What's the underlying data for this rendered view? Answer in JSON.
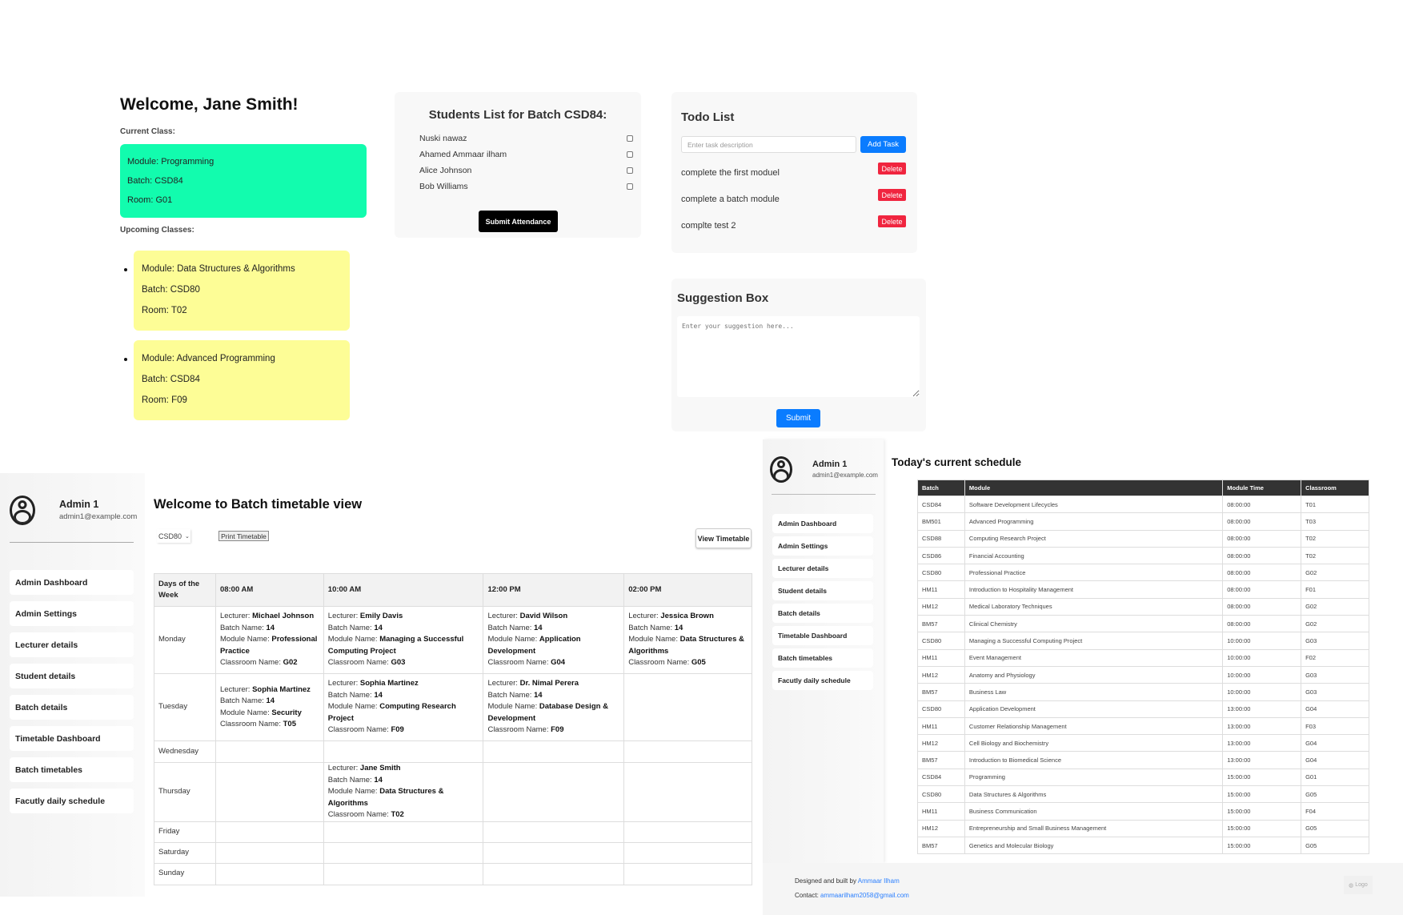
{
  "welcome": {
    "title": "Welcome, Jane Smith!",
    "current_label": "Current Class:",
    "current": {
      "module": "Module: Programming",
      "batch": "Batch: CSD84",
      "room": "Room: G01"
    },
    "upcoming_label": "Upcoming Classes:",
    "upcoming": [
      {
        "module": "Module: Data Structures & Algorithms",
        "batch": "Batch: CSD80",
        "room": "Room: T02"
      },
      {
        "module": "Module: Advanced Programming",
        "batch": "Batch: CSD84",
        "room": "Room: F09"
      }
    ]
  },
  "students": {
    "title": "Students List for Batch CSD84:",
    "list": [
      "Nuski nawaz",
      "Ahamed Ammaar ilham",
      "Alice Johnson",
      "Bob Williams"
    ],
    "submit": "Submit Attendance"
  },
  "todo": {
    "title": "Todo List",
    "placeholder": "Enter task description",
    "add": "Add Task",
    "tasks": [
      "complete the first moduel",
      "complete a batch module",
      "complte test 2"
    ],
    "delete": "Delete"
  },
  "suggestion": {
    "title": "Suggestion Box",
    "placeholder": "Enter your suggestion here...",
    "submit": "Submit"
  },
  "admin": {
    "name": "Admin 1",
    "email": "admin1@example.com",
    "nav": [
      "Admin Dashboard",
      "Admin Settings",
      "Lecturer details",
      "Student details",
      "Batch details",
      "Timetable Dashboard",
      "Batch timetables",
      "Facutly daily schedule"
    ]
  },
  "timetable": {
    "title": "Welcome to Batch timetable view",
    "batch_select": "CSD80",
    "print": "Print Timetable",
    "view": "View Timetable",
    "headers": [
      "Days of the Week",
      "08:00 AM",
      "10:00 AM",
      "12:00 PM",
      "02:00 PM"
    ],
    "labels": {
      "lecturer": "Lecturer: ",
      "batch": "Batch Name: ",
      "module": "Module Name: ",
      "room": "Classroom Name: "
    },
    "rows": [
      {
        "day": "Monday",
        "cells": [
          {
            "lecturer": "Michael Johnson",
            "batch": "14",
            "module": "Professional Practice",
            "room": "G02"
          },
          {
            "lecturer": "Emily Davis",
            "batch": "14",
            "module": "Managing a Successful Computing Project",
            "room": "G03"
          },
          {
            "lecturer": "David Wilson",
            "batch": "14",
            "module": "Application Development",
            "room": "G04"
          },
          {
            "lecturer": "Jessica Brown",
            "batch": "14",
            "module": "Data Structures & Algorithms",
            "room": "G05"
          }
        ]
      },
      {
        "day": "Tuesday",
        "cells": [
          {
            "lecturer": "Sophia Martinez",
            "batch": "14",
            "module": "Security",
            "room": "T05"
          },
          {
            "lecturer": "Sophia Martinez",
            "batch": "14",
            "module": "Computing Research Project",
            "room": "F09"
          },
          {
            "lecturer": "Dr. Nimal Perera",
            "batch": "14",
            "module": "Database Design & Development",
            "room": "F09"
          },
          null
        ]
      },
      {
        "day": "Wednesday",
        "cells": [
          null,
          null,
          null,
          null
        ]
      },
      {
        "day": "Thursday",
        "cells": [
          null,
          {
            "lecturer": "Jane Smith",
            "batch": "14",
            "module": "Data Structures & Algorithms",
            "room": "T02"
          },
          null,
          null
        ]
      },
      {
        "day": "Friday",
        "cells": [
          null,
          null,
          null,
          null
        ]
      },
      {
        "day": "Saturday",
        "cells": [
          null,
          null,
          null,
          null
        ]
      },
      {
        "day": "Sunday",
        "cells": [
          null,
          null,
          null,
          null
        ]
      }
    ]
  },
  "schedule": {
    "title": "Today's current schedule",
    "headers": [
      "Batch",
      "Module",
      "Module Time",
      "Classroom"
    ],
    "rows": [
      [
        "CSD84",
        "Software Development Lifecycles",
        "08:00:00",
        "T01"
      ],
      [
        "BM501",
        "Advanced Programming",
        "08:00:00",
        "T03"
      ],
      [
        "CSD88",
        "Computing Research Project",
        "08:00:00",
        "T02"
      ],
      [
        "CSD86",
        "Financial Accounting",
        "08:00:00",
        "T02"
      ],
      [
        "CSD80",
        "Professional Practice",
        "08:00:00",
        "G02"
      ],
      [
        "HM11",
        "Introduction to Hospitality Management",
        "08:00:00",
        "F01"
      ],
      [
        "HM12",
        "Medical Laboratory Techniques",
        "08:00:00",
        "G02"
      ],
      [
        "BM57",
        "Clinical Chemistry",
        "08:00:00",
        "G02"
      ],
      [
        "CSD80",
        "Managing a Successful Computing Project",
        "10:00:00",
        "G03"
      ],
      [
        "HM11",
        "Event Management",
        "10:00:00",
        "F02"
      ],
      [
        "HM12",
        "Anatomy and Physiology",
        "10:00:00",
        "G03"
      ],
      [
        "BM57",
        "Business Law",
        "10:00:00",
        "G03"
      ],
      [
        "CSD80",
        "Application Development",
        "13:00:00",
        "G04"
      ],
      [
        "HM11",
        "Customer Relationship Management",
        "13:00:00",
        "F03"
      ],
      [
        "HM12",
        "Cell Biology and Biochemistry",
        "13:00:00",
        "G04"
      ],
      [
        "BM57",
        "Introduction to Biomedical Science",
        "13:00:00",
        "G04"
      ],
      [
        "CSD84",
        "Programming",
        "15:00:00",
        "G01"
      ],
      [
        "CSD80",
        "Data Structures & Algorithms",
        "15:00:00",
        "G05"
      ],
      [
        "HM11",
        "Business Communication",
        "15:00:00",
        "F04"
      ],
      [
        "HM12",
        "Entrepreneurship and Small Business Management",
        "15:00:00",
        "G05"
      ],
      [
        "BM57",
        "Genetics and Molecular Biology",
        "15:00:00",
        "G05"
      ]
    ]
  },
  "footer": {
    "designed": "Designed and built by ",
    "author": "Ammaar Ilham",
    "contact": "Contact: ",
    "email": "ammaarilham2058@gmail.com",
    "logo": "Logo"
  }
}
